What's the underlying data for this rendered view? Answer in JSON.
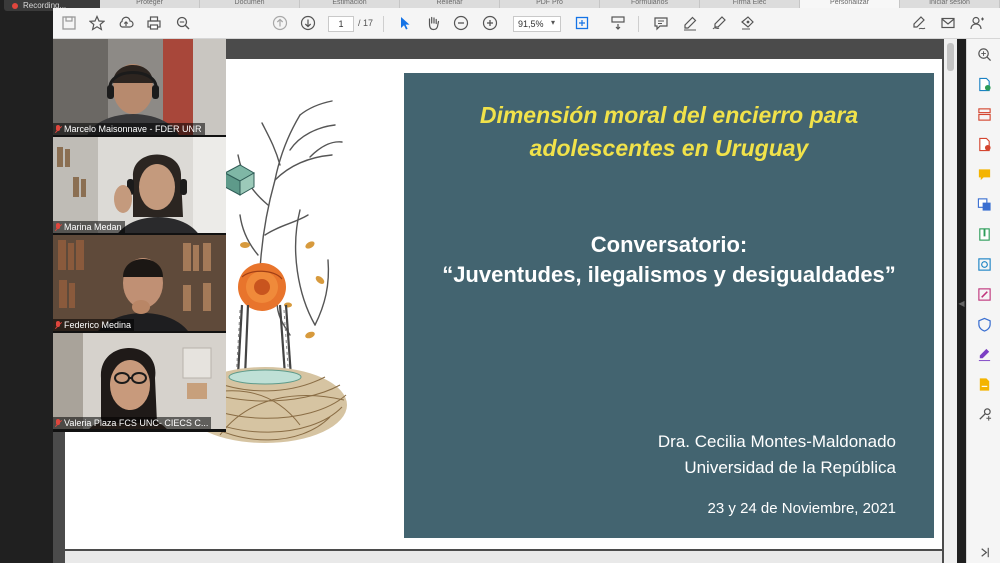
{
  "recording": {
    "label": "Recording..."
  },
  "tabs": [
    "Proteger",
    "Documen",
    "Estimación",
    "Rellenar",
    "PDF Pro",
    "Formularios",
    "Firma Elec",
    "Personalizar",
    "Iniciar sesión"
  ],
  "toolbar": {
    "page_current": "1",
    "page_total": "/ 17",
    "zoom": "91,5%"
  },
  "participants": [
    {
      "name": "Marcelo Maisonnave - FDER UNR"
    },
    {
      "name": "Marina Medan"
    },
    {
      "name": "Federico Medina"
    },
    {
      "name": "Valeria Plaza FCS UNC- CIECS C..."
    }
  ],
  "slide": {
    "title_line1": "Dimensión moral del encierro para",
    "title_line2": "adolescentes en Uruguay",
    "sub_line1": "Conversatorio:",
    "sub_line2": "“Juventudes, ilegalismos y desigualdades”",
    "author": "Dra. Cecilia Montes-Maldonado",
    "institution": "Universidad de la República",
    "date": "23 y 24 de Noviembre, 2021"
  },
  "colors": {
    "slide_bg": "#436470",
    "title_yellow": "#f1e24a",
    "accent_blue": "#1473e6",
    "mic_red": "#e0463d"
  }
}
